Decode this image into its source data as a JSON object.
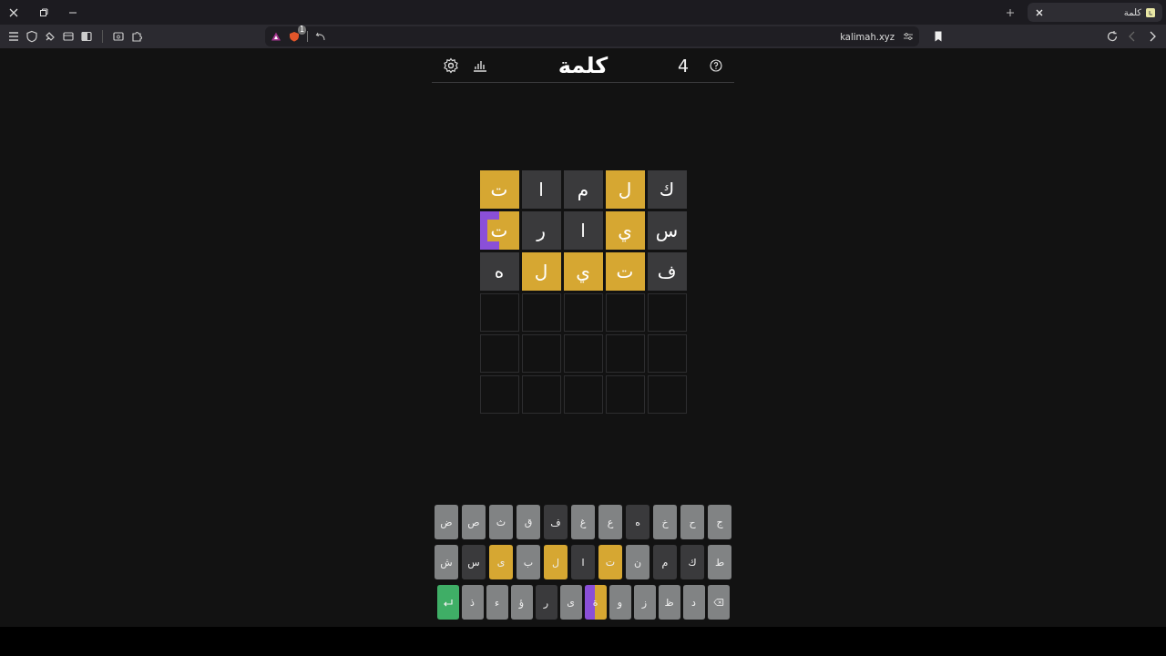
{
  "browser": {
    "tab": {
      "title": "كلمة",
      "selected": true
    },
    "url": "kalimah.xyz",
    "shield_badge": "1"
  },
  "header": {
    "title": "كلمة",
    "streak": "4"
  },
  "board": {
    "rows": [
      {
        "tiles": [
          {
            "letter": "ك",
            "kind": "absent"
          },
          {
            "letter": "ل",
            "kind": "present"
          },
          {
            "letter": "م",
            "kind": "absent"
          },
          {
            "letter": "ا",
            "kind": "absent"
          },
          {
            "letter": "ت",
            "kind": "present"
          }
        ]
      },
      {
        "tiles": [
          {
            "letter": "س",
            "kind": "absent"
          },
          {
            "letter": "ي",
            "kind": "present"
          },
          {
            "letter": "ا",
            "kind": "absent"
          },
          {
            "letter": "ر",
            "kind": "absent"
          },
          {
            "letter": "ت",
            "kind": "split"
          }
        ]
      },
      {
        "tiles": [
          {
            "letter": "ف",
            "kind": "absent"
          },
          {
            "letter": "ت",
            "kind": "present"
          },
          {
            "letter": "ي",
            "kind": "present"
          },
          {
            "letter": "ل",
            "kind": "present"
          },
          {
            "letter": "ه",
            "kind": "absent"
          }
        ]
      },
      {
        "tiles": [
          {
            "kind": "empty"
          },
          {
            "kind": "empty"
          },
          {
            "kind": "empty"
          },
          {
            "kind": "empty"
          },
          {
            "kind": "empty"
          }
        ]
      },
      {
        "tiles": [
          {
            "kind": "empty"
          },
          {
            "kind": "empty"
          },
          {
            "kind": "empty"
          },
          {
            "kind": "empty"
          },
          {
            "kind": "empty"
          }
        ]
      },
      {
        "tiles": [
          {
            "kind": "empty"
          },
          {
            "kind": "empty"
          },
          {
            "kind": "empty"
          },
          {
            "kind": "empty"
          },
          {
            "kind": "empty"
          }
        ]
      }
    ]
  },
  "keyboard": {
    "rows": [
      {
        "keys": [
          {
            "label": "ج",
            "kind": "unused"
          },
          {
            "label": "ح",
            "kind": "unused"
          },
          {
            "label": "خ",
            "kind": "unused"
          },
          {
            "label": "ه",
            "kind": "absent"
          },
          {
            "label": "ع",
            "kind": "unused"
          },
          {
            "label": "غ",
            "kind": "unused"
          },
          {
            "label": "ف",
            "kind": "absent"
          },
          {
            "label": "ق",
            "kind": "unused"
          },
          {
            "label": "ث",
            "kind": "unused"
          },
          {
            "label": "ص",
            "kind": "unused"
          },
          {
            "label": "ض",
            "kind": "unused"
          }
        ]
      },
      {
        "keys": [
          {
            "label": "ط",
            "kind": "unused"
          },
          {
            "label": "ك",
            "kind": "absent"
          },
          {
            "label": "م",
            "kind": "absent"
          },
          {
            "label": "ن",
            "kind": "unused"
          },
          {
            "label": "ت",
            "kind": "present"
          },
          {
            "label": "ا",
            "kind": "absent"
          },
          {
            "label": "ل",
            "kind": "present"
          },
          {
            "label": "ب",
            "kind": "unused"
          },
          {
            "label": "ى",
            "kind": "present"
          },
          {
            "label": "س",
            "kind": "absent"
          },
          {
            "label": "ش",
            "kind": "unused"
          }
        ]
      },
      {
        "keys": [
          {
            "kind": "backspace"
          },
          {
            "label": "د",
            "kind": "unused"
          },
          {
            "label": "ظ",
            "kind": "unused"
          },
          {
            "label": "ز",
            "kind": "unused"
          },
          {
            "label": "و",
            "kind": "unused"
          },
          {
            "label": "ة",
            "kind": "split"
          },
          {
            "label": "ى",
            "kind": "unused"
          },
          {
            "label": "ر",
            "kind": "absent"
          },
          {
            "label": "ؤ",
            "kind": "unused"
          },
          {
            "label": "ء",
            "kind": "unused"
          },
          {
            "label": "ذ",
            "kind": "unused"
          },
          {
            "kind": "enter"
          }
        ]
      }
    ]
  }
}
